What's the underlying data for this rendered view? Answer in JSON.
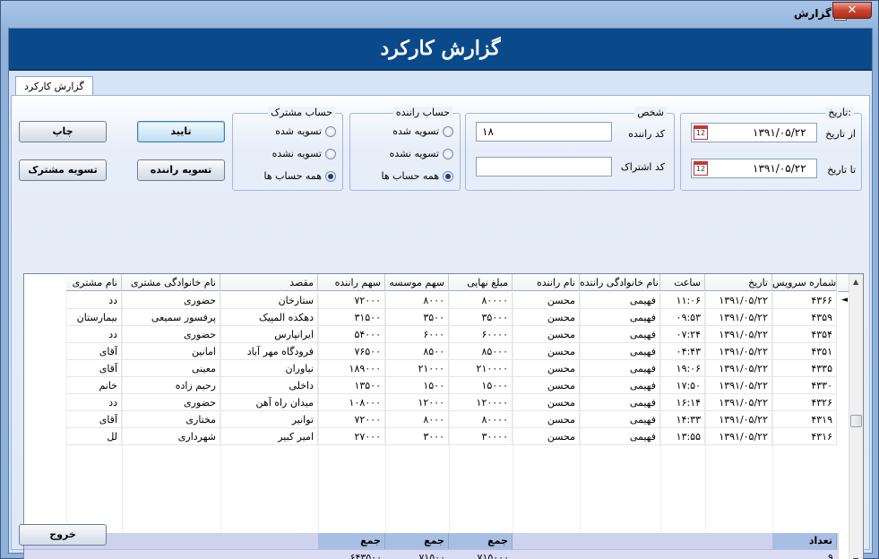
{
  "window": {
    "title": "گزارش",
    "close_glyph": "✕"
  },
  "header": {
    "title": "گزارش کارکرد"
  },
  "tab": {
    "label": "گزارش کارکرد"
  },
  "date_group": {
    "legend": "تاریخ:",
    "from_label": "از تاریخ",
    "from_value": "۱۳۹۱/۰۵/۲۲",
    "to_label": "تا تاریخ",
    "to_value": "۱۳۹۱/۰۵/۲۲",
    "calendar_glyph": "12"
  },
  "person_group": {
    "legend": "شخص",
    "driver_code_label": "کد راننده",
    "driver_code_value": "۱۸",
    "subscription_code_label": "کد اشتراک",
    "subscription_code_value": ""
  },
  "driver_account_group": {
    "legend": "حساب راننده",
    "options": [
      "تسویه شده",
      "تسویه نشده",
      "همه حساب ها"
    ],
    "selected_index": 2
  },
  "customer_account_group": {
    "legend": "حساب مشترک",
    "options": [
      "تسویه شده",
      "تسویه نشده",
      "همه حساب ها"
    ],
    "selected_index": 2
  },
  "buttons": {
    "confirm": "تایید",
    "print": "چاپ",
    "settle_driver": "تسویه راننده",
    "settle_customer": "تسویه مشترک",
    "exit": "خروج"
  },
  "table": {
    "columns": [
      "شماره سرویس",
      "تاریخ",
      "ساعت",
      "نام خانوادگی راننده",
      "نام راننده",
      "مبلغ نهایی",
      "سهم موسسه",
      "سهم راننده",
      "مقصد",
      "نام خانوادگی مشتری",
      "نام مشتری"
    ],
    "rows": [
      [
        "۴۳۶۶",
        "۱۳۹۱/۰۵/۲۲",
        "۱۱:۰۶",
        "فهیمی",
        "محسن",
        "۸۰۰۰۰",
        "۸۰۰۰",
        "۷۲۰۰۰",
        "ستارخان",
        "حضوری",
        "دد"
      ],
      [
        "۴۳۵۹",
        "۱۳۹۱/۰۵/۲۲",
        "۰۹:۵۳",
        "فهیمی",
        "محسن",
        "۳۵۰۰۰",
        "۳۵۰۰",
        "۳۱۵۰۰",
        "دهکده المپیک",
        "پرفسور سمیعی",
        "بیمارستان"
      ],
      [
        "۴۳۵۴",
        "۱۳۹۱/۰۵/۲۲",
        "۰۷:۲۴",
        "فهیمی",
        "محسن",
        "۶۰۰۰۰",
        "۶۰۰۰",
        "۵۴۰۰۰",
        "ایرانپارس",
        "حضوری",
        "دد"
      ],
      [
        "۴۳۵۱",
        "۱۳۹۱/۰۵/۲۲",
        "۰۴:۴۳",
        "فهیمی",
        "محسن",
        "۸۵۰۰۰",
        "۸۵۰۰",
        "۷۶۵۰۰",
        "فرودگاه مهر آباد",
        "امانین",
        "آقای"
      ],
      [
        "۴۳۳۵",
        "۱۳۹۱/۰۵/۲۲",
        "۱۹:۰۶",
        "فهیمی",
        "محسن",
        "۲۱۰۰۰۰",
        "۲۱۰۰۰",
        "۱۸۹۰۰۰",
        "نیاوران",
        "معینی",
        "آقای"
      ],
      [
        "۴۳۳۰",
        "۱۳۹۱/۰۵/۲۲",
        "۱۷:۵۰",
        "فهیمی",
        "محسن",
        "۱۵۰۰۰",
        "۱۵۰۰",
        "۱۳۵۰۰",
        "داخلی",
        "رحیم زاده",
        "خانم"
      ],
      [
        "۴۳۲۶",
        "۱۳۹۱/۰۵/۲۲",
        "۱۶:۱۴",
        "فهیمی",
        "محسن",
        "۱۲۰۰۰۰",
        "۱۲۰۰۰",
        "۱۰۸۰۰۰",
        "میدان راه آهن",
        "حضوری",
        "دد"
      ],
      [
        "۴۳۱۹",
        "۱۳۹۱/۰۵/۲۲",
        "۱۴:۳۳",
        "فهیمی",
        "محسن",
        "۸۰۰۰۰",
        "۸۰۰۰",
        "۷۲۰۰۰",
        "توانیر",
        "مختاری",
        "آقای"
      ],
      [
        "۴۳۱۶",
        "۱۳۹۱/۰۵/۲۲",
        "۱۳:۵۵",
        "فهیمی",
        "محسن",
        "۳۰۰۰۰",
        "۳۰۰۰",
        "۲۷۰۰۰",
        "امیر کبیر",
        "شهرداری",
        "لل"
      ]
    ]
  },
  "footer": {
    "count_label": "تعداد",
    "count_value": "۹",
    "sum_label": "جمع",
    "final_amount_sum": "۷۱۵۰۰۰",
    "institute_share_sum": "۷۱۵۰۰",
    "driver_share_sum": "۶۴۳۵۰۰"
  },
  "scrollbar": {
    "up": "▲",
    "down": "▼",
    "left": "◄",
    "right": "►",
    "grip": "|||"
  },
  "row_indicator": "◄"
}
